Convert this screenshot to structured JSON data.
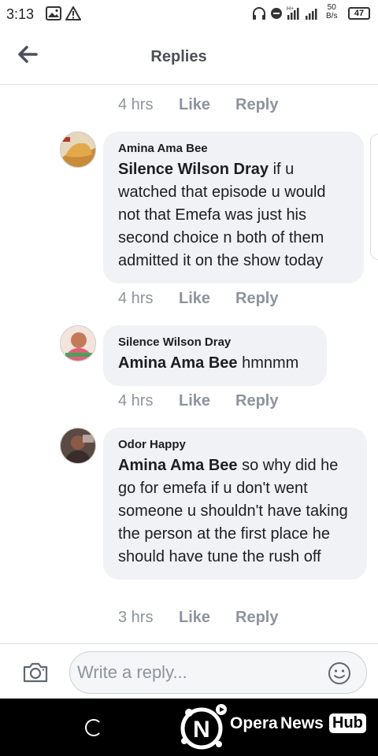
{
  "status_bar": {
    "time": "3:13",
    "net_speed_value": "50",
    "net_speed_unit": "B/s",
    "battery": "47",
    "network_label": "H+"
  },
  "header": {
    "title": "Replies",
    "back_icon": "arrow-left-icon"
  },
  "comments": [
    {
      "time": "4 hrs",
      "like": "Like",
      "reply": "Reply"
    },
    {
      "author": "Amina Ama Bee",
      "tag": "Silence Wilson Dray",
      "text": "if u watched that episode u would not that Emefa was just his second choice n both of them admitted it on the show today",
      "time": "4 hrs",
      "like": "Like",
      "reply": "Reply"
    },
    {
      "author": "Silence Wilson Dray",
      "tag": "Amina Ama Bee",
      "text": "hmnmm",
      "time": "4 hrs",
      "like": "Like",
      "reply": "Reply"
    },
    {
      "author": "Odor Happy",
      "tag": "Amina Ama Bee",
      "text": "so why did he go for emefa if u don't went someone u shouldn't have taking the person at the first place he should have tune the rush off",
      "time": "3 hrs",
      "like": "Like",
      "reply": "Reply"
    }
  ],
  "composer": {
    "placeholder": "Write a reply...",
    "camera_icon": "camera-icon",
    "emoji_icon": "smiley-icon"
  },
  "branding": {
    "part1": "Opera",
    "part2": "News",
    "part3": "Hub"
  },
  "colors": {
    "bubble": "#f0f2f5",
    "meta": "#8d949e",
    "divider": "#dadde1"
  }
}
